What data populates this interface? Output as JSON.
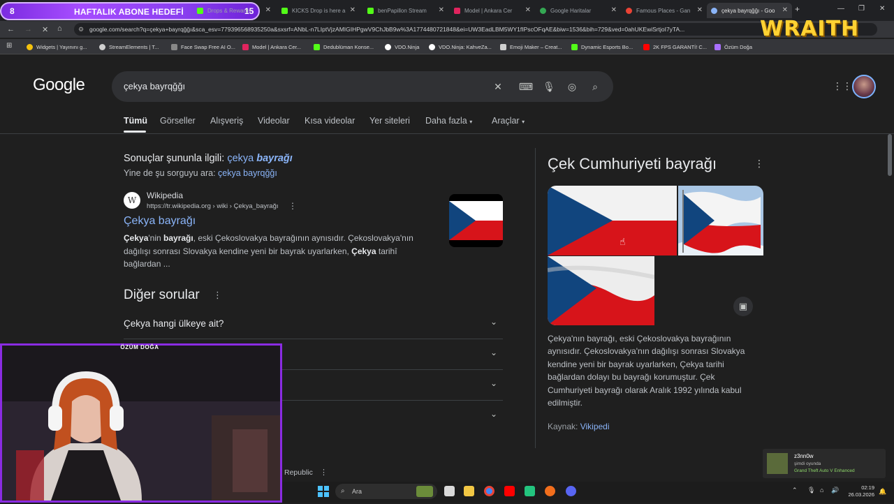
{
  "overlay": {
    "goal_count": "8",
    "goal_label": "HAFTALIK ABONE HEDEFİ",
    "goal_target": "15",
    "streamer_logo": "WRAITH",
    "webcam_name": "ÖZÜM DOĞA"
  },
  "browser": {
    "tabs": [
      {
        "label": "Drops & Rewards",
        "color": "#53fc18"
      },
      {
        "label": "KICKS Drop is here a",
        "color": "#53fc18"
      },
      {
        "label": "benPapillon Stream",
        "color": "#53fc18"
      },
      {
        "label": "Model | Ankara Cer",
        "color": "#e0245e"
      },
      {
        "label": "Google Haritalar",
        "color": "#34a853"
      },
      {
        "label": "Famous Places - Gan",
        "color": "#ea4335"
      },
      {
        "label": "çekya bayrqğğı - Goo",
        "color": "#8ab4f8"
      }
    ],
    "new_tab": "+",
    "url": "google.com/search?q=çekya+bayrqğğı&sca_esv=779396568935250a&sxsrf=ANbL-n7LIptVjzAMIGIHPgwV9ChJbB9w%3A1774480721848&ei=UW3EadLBM5WY1fIPscOFqAE&biw=1536&bih=729&ved=0ahUKEwiSrtjoI7yTA...",
    "bookmarks": [
      {
        "label": "Widgets | Yayınını g...",
        "color": "#f4c20d"
      },
      {
        "label": "StreamElements | T...",
        "color": "#cfcfcf"
      },
      {
        "label": "Face Swap Free AI O...",
        "color": "#888888"
      },
      {
        "label": "Model | Ankara Cer...",
        "color": "#e0245e"
      },
      {
        "label": "Dedublüman Konse...",
        "color": "#53fc18"
      },
      {
        "label": "VDO.Ninja",
        "color": "#ffffff"
      },
      {
        "label": "VDO.Ninja: KahveZa...",
        "color": "#ffffff"
      },
      {
        "label": "Emoji Maker – Creat...",
        "color": "#cfcfcf"
      },
      {
        "label": "Dynamic Esports Bo...",
        "color": "#53fc18"
      },
      {
        "label": "2K FPS GARANTİ! C...",
        "color": "#ff0000"
      },
      {
        "label": "Özüm Doğa",
        "color": "#a970ff"
      }
    ]
  },
  "google": {
    "logo": "Google",
    "query": "çekya bayrqğğı",
    "filter_tabs": [
      "Tümü",
      "Görseller",
      "Alışveriş",
      "Videolar",
      "Kısa videolar",
      "Yer siteleri",
      "Daha fazla",
      "Araçlar"
    ],
    "correction_prefix": "Sonuçlar şununla ilgili:",
    "correction_plain": "çekya",
    "correction_bold": "bayrağı",
    "original_prefix": "Yine de şu sorguyu ara:",
    "original_query": "çekya bayrqğğı",
    "result": {
      "site_name": "Wikipedia",
      "site_url": "https://tr.wikipedia.org › wiki › Çekya_bayrağı",
      "title": "Çekya bayrağı",
      "snippet_1": "Çekya",
      "snippet_2": "'nin ",
      "snippet_3": "bayrağı",
      "snippet_4": ", eski Çekoslovakya bayrağının aynısıdır. Çekoslovakya'nın dağılışı sonrası Slovakya kendine yeni bir bayrak uyarlarken, ",
      "snippet_5": "Çekya",
      "snippet_6": " tarihî bağlardan ..."
    },
    "paa_title": "Diğer sorular",
    "paa_items": [
      "Çekya hangi ülkeye ait?",
      "",
      "",
      ""
    ],
    "footer_fragment": "Republic"
  },
  "knowledge_panel": {
    "title": "Çek Cumhuriyeti bayrağı",
    "description": "Çekya'nın bayrağı, eski Çekoslovakya bayrağının aynısıdır. Çekoslovakya'nın dağılışı sonrası Slovakya kendine yeni bir bayrak uyarlarken, Çekya tarihi bağlardan dolayı bu bayrağı korumuştur. Çek Cumhuriyeti bayrağı olarak Aralık 1992 yılında kabul edilmiştir.",
    "source_label": "Kaynak:",
    "source_link": "Vikipedi"
  },
  "notification": {
    "user": "z3nn0w",
    "status": "şimdi oyunda",
    "game": "Grand Theft Auto V Enhanced"
  },
  "taskbar": {
    "search_placeholder": "Ara",
    "time": "02:19",
    "date": "26.03.2026"
  },
  "colors": {
    "flag_blue": "#11457e",
    "flag_red": "#d7141a",
    "flag_white": "#ffffff",
    "link": "#8ab4f8",
    "accent_purple": "#8a2be2"
  }
}
